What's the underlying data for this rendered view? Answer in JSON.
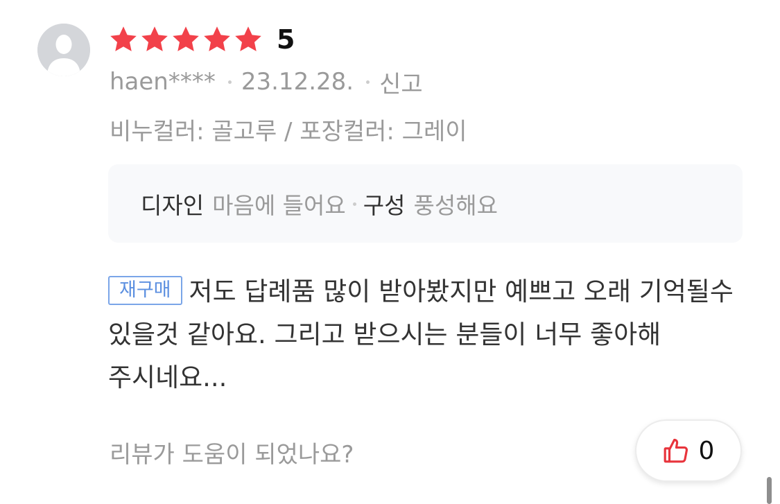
{
  "review": {
    "rating": 5,
    "rating_label": "5",
    "reviewer": "haen****",
    "date": "23.12.28.",
    "report_label": "신고",
    "option_text": "비누컬러: 골고루 / 포장컬러: 그레이",
    "summary": [
      {
        "label": "디자인",
        "value": "마음에 들어요"
      },
      {
        "label": "구성",
        "value": "풍성해요"
      }
    ],
    "repurchase_badge": "재구매",
    "body": "저도 답례품 많이 받아봤지만 예쁘고 오래 기억될수 있을것 같아요. 그리고 받으시는 분들이 너무 좋아해 주시네요..."
  },
  "helpful": {
    "question": "리뷰가 도움이 되었나요?",
    "like_count": "0"
  },
  "icons": {
    "avatar": "user-silhouette-icon",
    "star": "star-filled-icon",
    "thumb": "thumbs-up-outline-icon"
  },
  "colors": {
    "star": "#f2414a",
    "thumb": "#e8343c",
    "badge": "#5b8fe0",
    "muted_text": "#9a9a9a",
    "summary_bg": "#f8f9fb"
  }
}
